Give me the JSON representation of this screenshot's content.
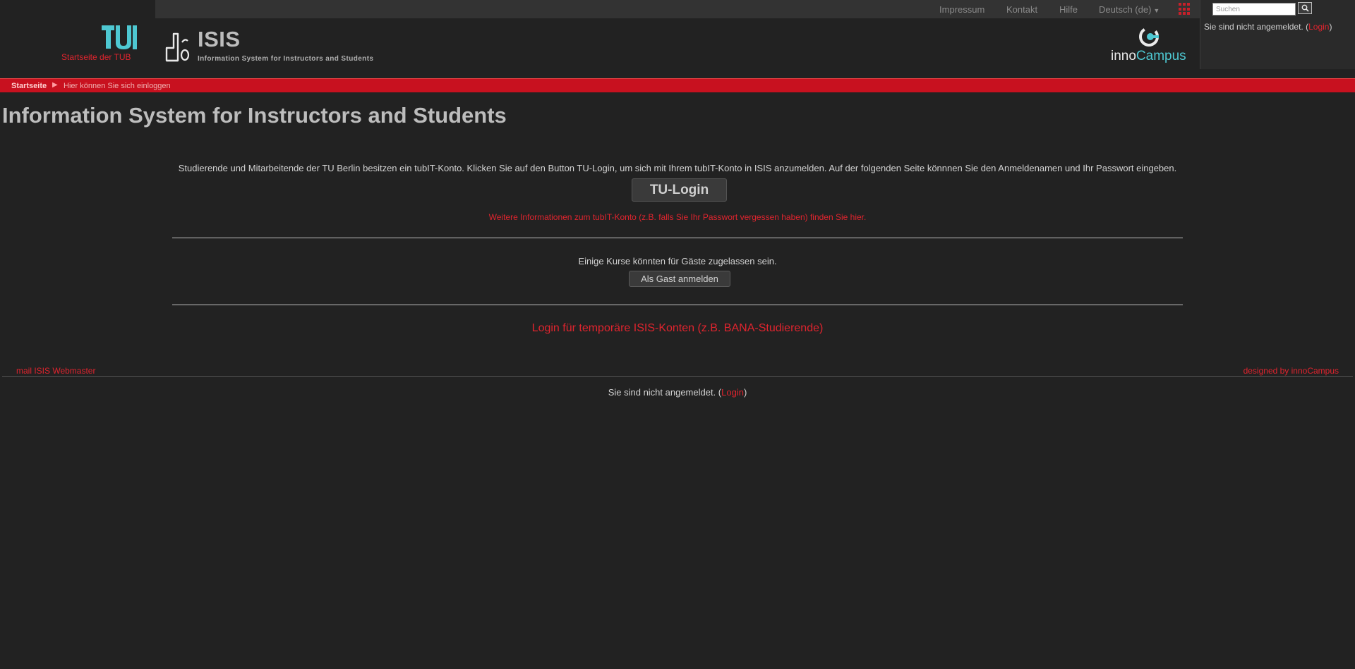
{
  "top_nav": {
    "impressum": "Impressum",
    "kontakt": "Kontakt",
    "hilfe": "Hilfe",
    "language": "Deutsch (de)"
  },
  "search": {
    "placeholder": "Suchen"
  },
  "login_status": {
    "prefix": "Sie sind nicht angemeldet. (",
    "link": "Login",
    "suffix": ")"
  },
  "header": {
    "tub_label": "Startseite der TUB",
    "isis_title": "ISIS",
    "isis_subtitle": "Information System for Instructors and Students",
    "inno_part1": "inno",
    "inno_part2": "Campus"
  },
  "breadcrumb": {
    "home": "Startseite",
    "current": "Hier können Sie sich einloggen"
  },
  "main": {
    "title": "Information System for Instructors and Students",
    "intro": "Studierende und Mitarbeitende der TU Berlin besitzen ein tubIT-Konto. Klicken Sie auf den Button TU-Login, um sich mit Ihrem tubIT-Konto in ISIS anzumelden. Auf der folgenden Seite könnnen Sie den Anmeldenamen und Ihr Passwort eingeben.",
    "tu_login_button": "TU-Login",
    "more_info_link": "Weitere Informationen zum tubIT-Konto (z.B. falls Sie Ihr Passwort vergessen haben) finden Sie hier.",
    "guest_info": "Einige Kurse könnten für Gäste zugelassen sein.",
    "guest_button": "Als Gast anmelden",
    "temp_login_link": "Login für temporäre ISIS-Konten (z.B. BANA-Studierende)"
  },
  "footer": {
    "mail_link": "mail ISIS Webmaster",
    "designed_link": "designed by innoCampus"
  },
  "colors": {
    "accent_red": "#e0242e",
    "breadcrumb_red": "#c8111f",
    "background": "#222222",
    "tub_teal": "#4ec8d2"
  },
  "icons": {
    "search": "search-icon",
    "apps": "apps-grid-icon",
    "breadcrumb_separator": "triangle-right-icon"
  }
}
